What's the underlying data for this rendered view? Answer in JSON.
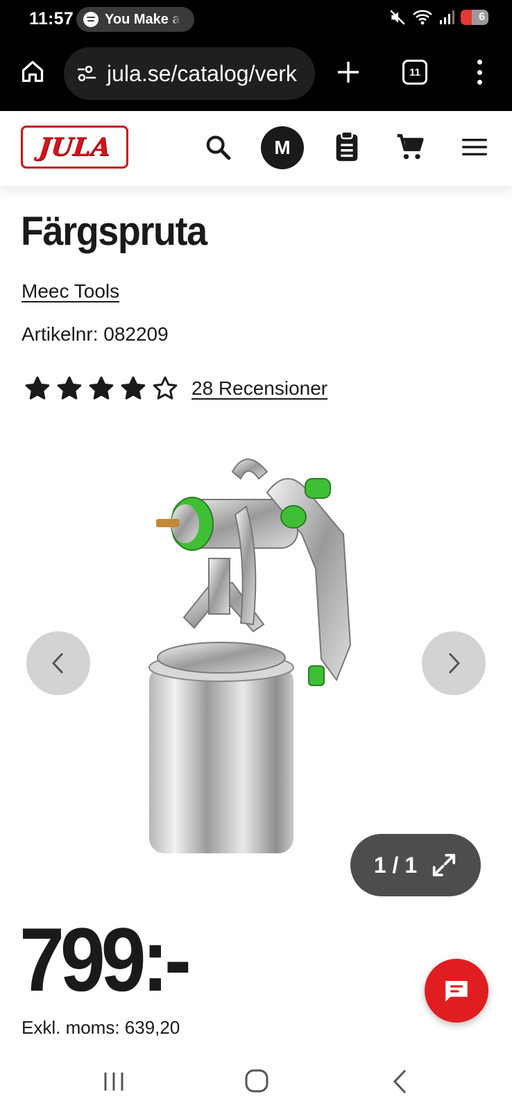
{
  "status_bar": {
    "time": "11:57",
    "now_playing": "You Make a",
    "battery_level": "6",
    "battery_color": "#e53935"
  },
  "browser": {
    "url": "jula.se/catalog/verk",
    "tab_count": "11",
    "icons": [
      "home-icon",
      "site-settings-icon",
      "new-tab-icon",
      "tabs-icon",
      "more-menu-icon"
    ]
  },
  "site_header": {
    "logo_text": "JULA",
    "avatar_initial": "M",
    "brand_color": "#d2141a",
    "icons": [
      "search-icon",
      "shopping-list-icon",
      "cart-icon",
      "hamburger-menu-icon"
    ]
  },
  "product": {
    "title": "Färgspruta",
    "brand": "Meec Tools",
    "article_label": "Artikelnr:",
    "article_number": "082209",
    "rating": {
      "value": 4,
      "max": 5,
      "reviews_label": "28 Recensioner"
    },
    "gallery": {
      "counter": "1 / 1",
      "image_description_icon": "spray-gun-image"
    },
    "price": "799:-",
    "price_excl_vat": "Exkl. moms: 639,20"
  },
  "system_nav": {
    "icons": [
      "recent-apps-icon",
      "home-button-icon",
      "back-icon"
    ]
  }
}
